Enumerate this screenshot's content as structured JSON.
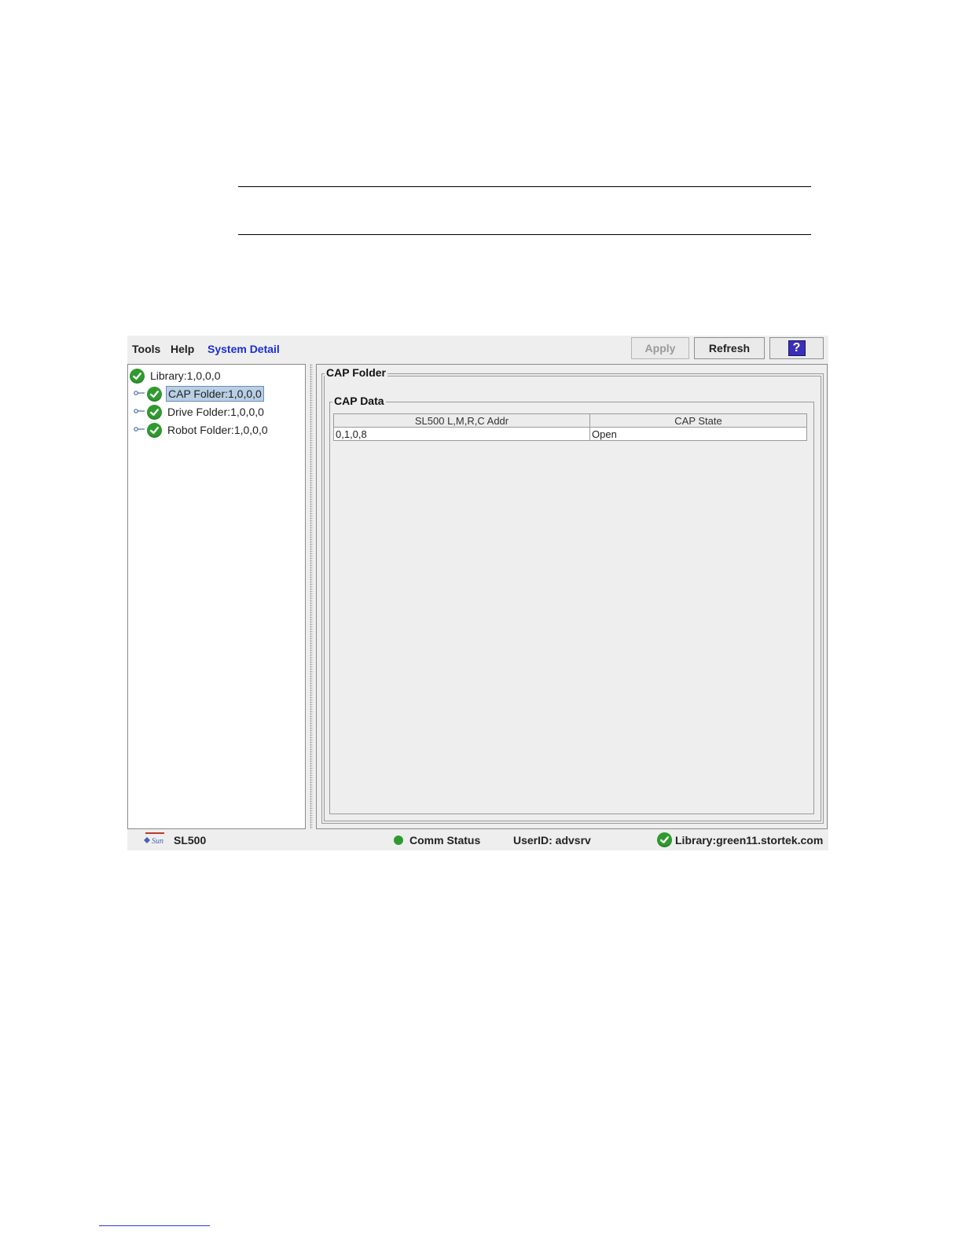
{
  "menubar": {
    "tools": "Tools",
    "help": "Help",
    "system_detail": "System Detail"
  },
  "toolbar": {
    "apply": "Apply",
    "refresh": "Refresh",
    "help_icon": "?"
  },
  "tree": {
    "items": [
      {
        "label": "Library:1,0,0,0",
        "icon": "check-icon"
      },
      {
        "label": "CAP Folder:1,0,0,0",
        "icon": "check-icon",
        "selected": true
      },
      {
        "label": "Drive Folder:1,0,0,0",
        "icon": "check-icon"
      },
      {
        "label": "Robot Folder:1,0,0,0",
        "icon": "check-icon"
      }
    ]
  },
  "panel": {
    "title": "CAP Folder",
    "group_title": "CAP Data",
    "table": {
      "headers": [
        "SL500 L,M,R,C Addr",
        "CAP State"
      ],
      "rows": [
        [
          "0,1,0,8",
          "Open"
        ]
      ]
    }
  },
  "statusbar": {
    "product": "SL500",
    "comm_status": "Comm Status",
    "user_id": "UserID: advsrv",
    "library": "Library:green11.stortek.com"
  },
  "colors": {
    "accent": "#1a2fd6",
    "ok_green": "#2f9b2f",
    "selection": "#b8cfe5"
  }
}
